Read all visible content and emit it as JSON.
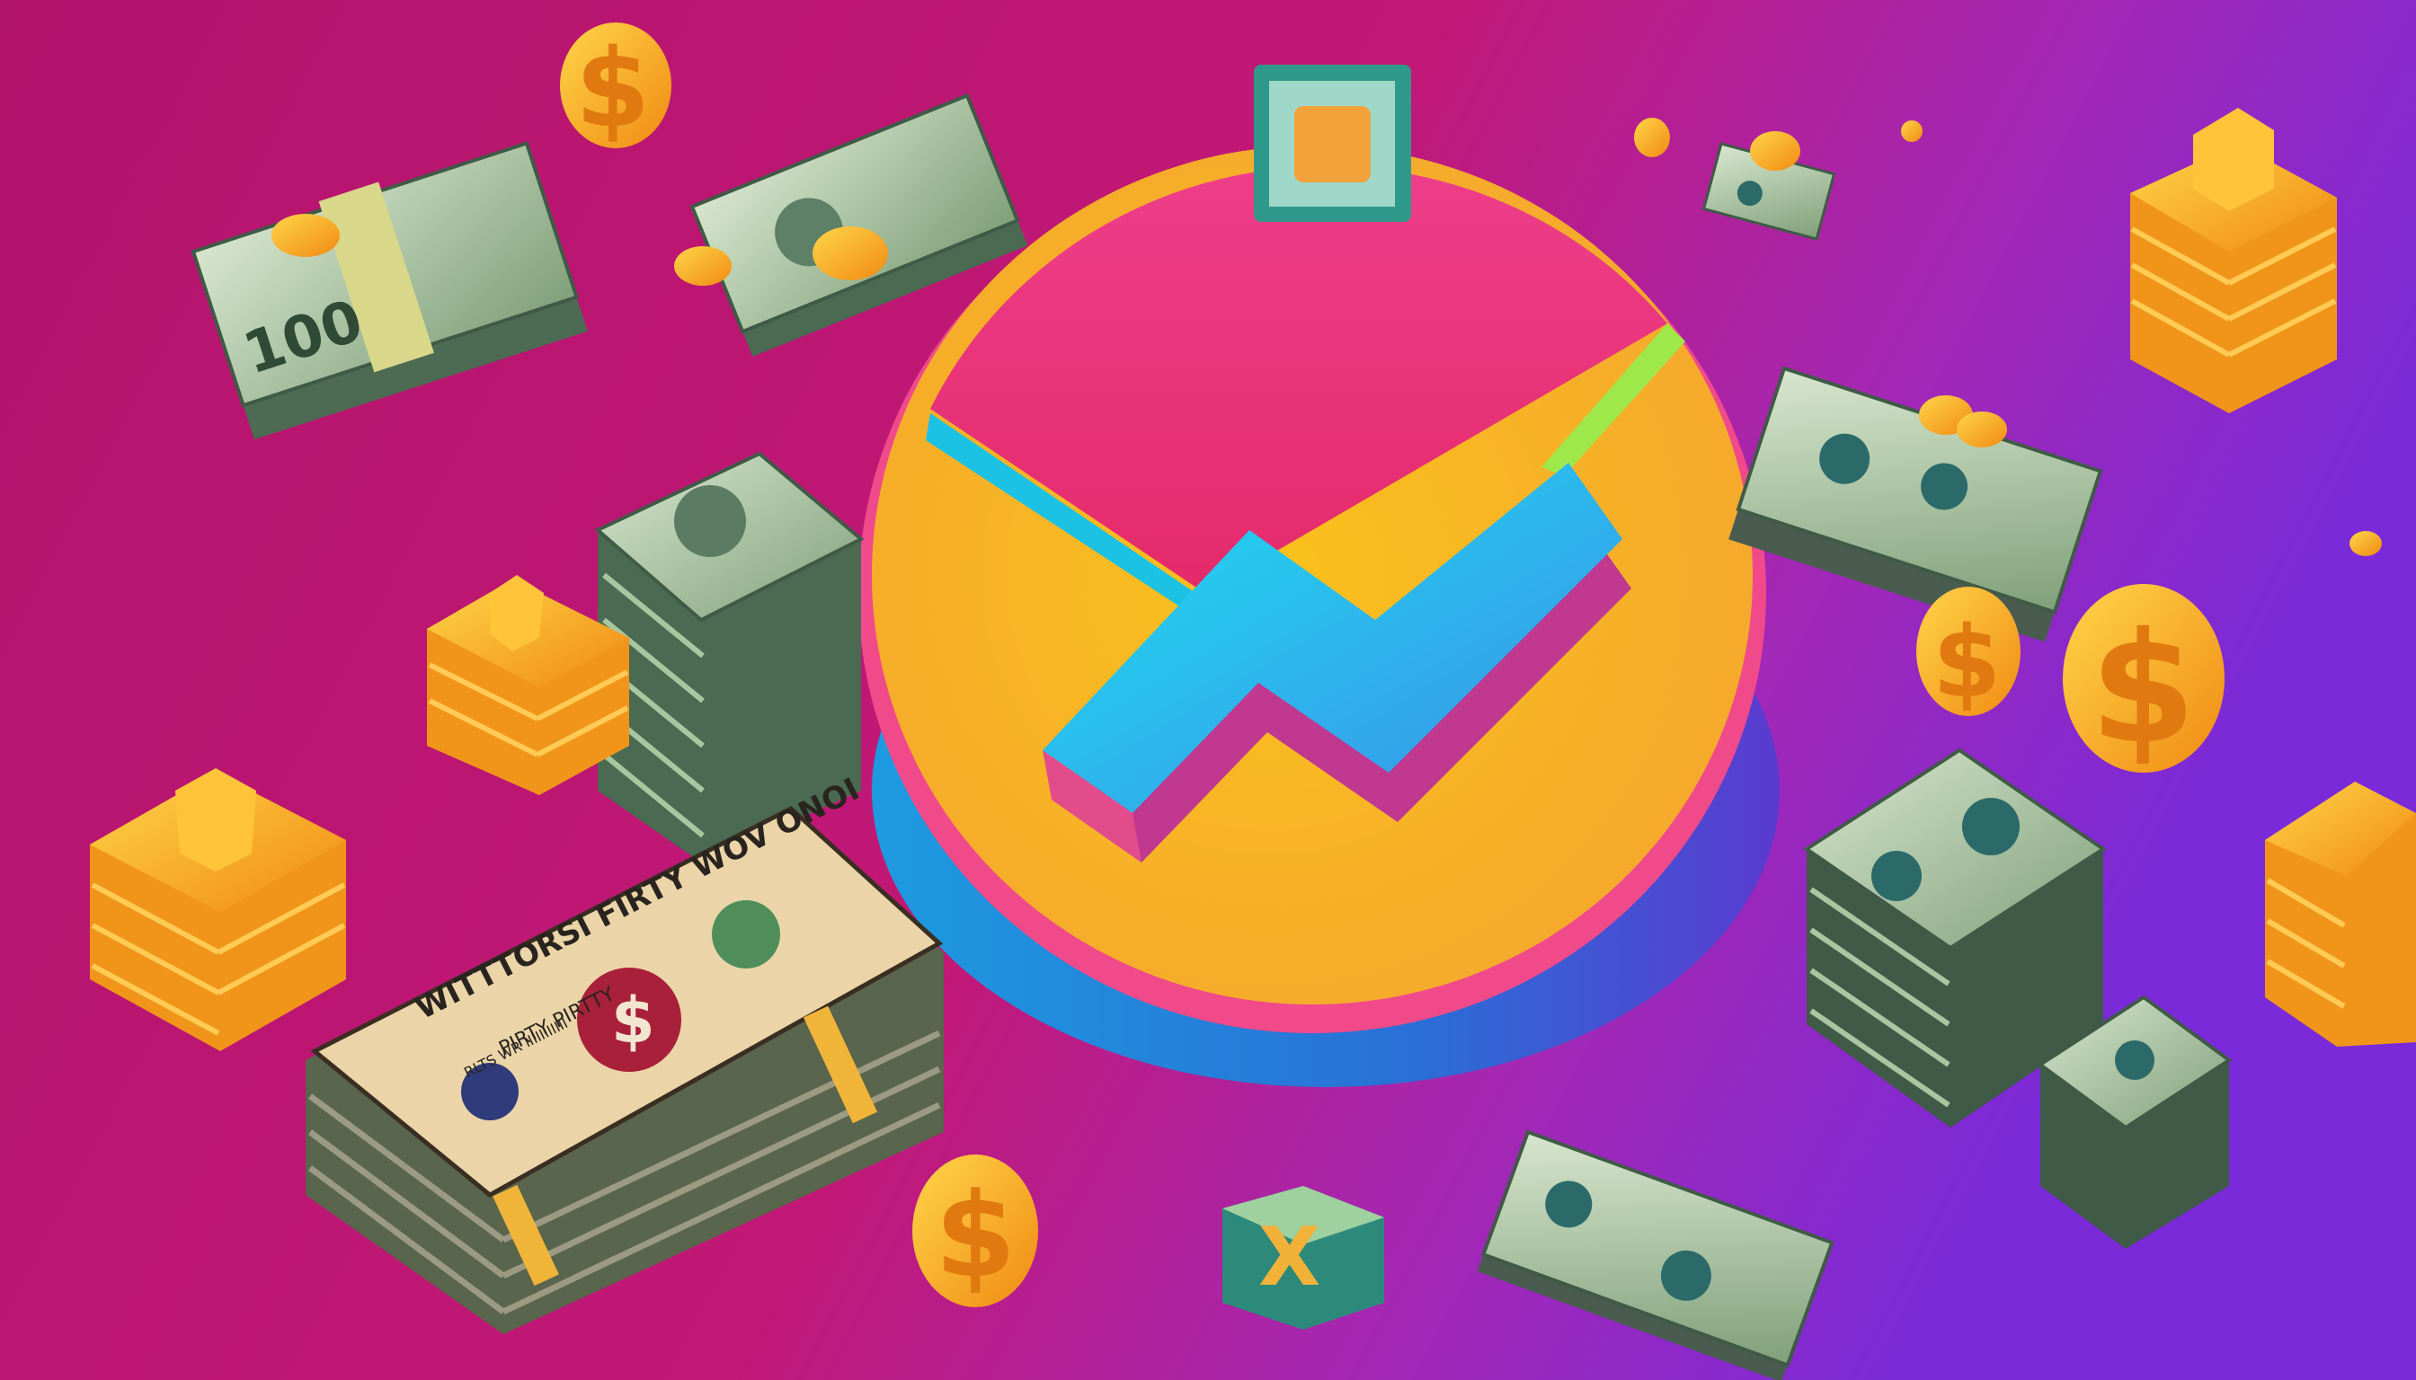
{
  "scene": {
    "kind": "illustration",
    "subject": "pie chart with upward arrow surrounded by money",
    "colors": {
      "background_left": "#b3146c",
      "background_right": "#7a2ad8",
      "pie_pink": "#ee2f7c",
      "pie_yellow": "#f7bc2a",
      "pie_base_blue": "#2f86e0",
      "arrow_cyan": "#22c8ee",
      "arrow_side": "#b0369a",
      "cash_green": "#9fbf96",
      "gold": "#f5a820"
    },
    "bill_texts": {
      "big_bill_top": "WITTTORSI FIRTY WOV ONOI",
      "big_bill_mid": "PIRTY PIRTTY",
      "big_bill_serial": "RLTS WR IIIIIIIIIII",
      "bill_corner": "100"
    },
    "icons": [
      "dollar-sign-icon",
      "coin-icon",
      "gold-stack-icon",
      "cash-stack-icon",
      "trend-arrow-icon"
    ]
  }
}
